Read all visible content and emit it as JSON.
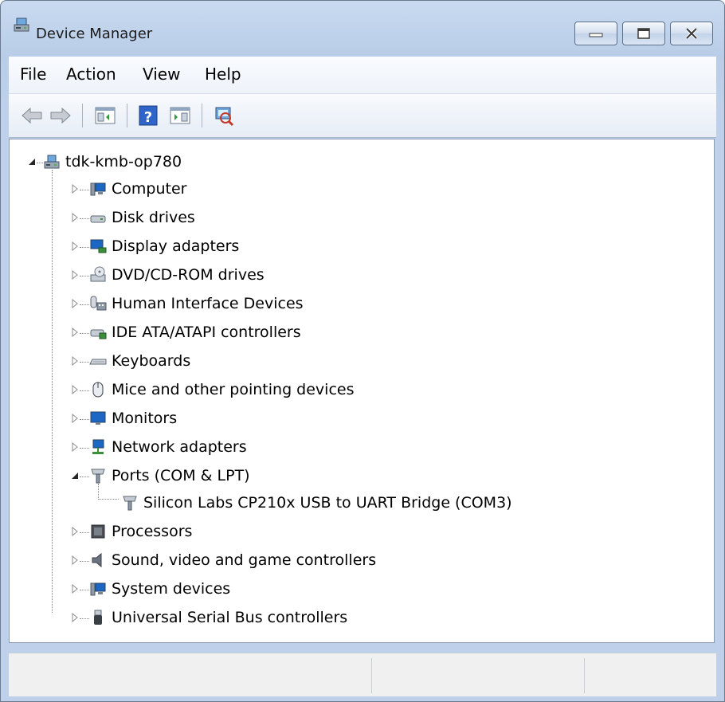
{
  "window": {
    "title": "Device Manager",
    "app_icon": "device-manager-icon",
    "caption_buttons": [
      "minimize-icon",
      "maximize-icon",
      "close-icon"
    ]
  },
  "menu": {
    "items": [
      "File",
      "Action",
      "View",
      "Help"
    ]
  },
  "toolbar": {
    "buttons": [
      "back-arrow-icon",
      "forward-arrow-icon",
      "show-hide-tree-icon",
      "help-icon",
      "properties-icon",
      "scan-hardware-icon"
    ]
  },
  "tree": {
    "root": {
      "label": "tdk-kmb-op780",
      "icon": "computer-workstation-icon",
      "expanded": true
    },
    "categories": [
      {
        "label": "Computer",
        "icon": "computer-icon",
        "expanded": false
      },
      {
        "label": "Disk drives",
        "icon": "disk-drive-icon",
        "expanded": false
      },
      {
        "label": "Display adapters",
        "icon": "display-adapter-icon",
        "expanded": false
      },
      {
        "label": "DVD/CD-ROM drives",
        "icon": "dvd-drive-icon",
        "expanded": false
      },
      {
        "label": "Human Interface Devices",
        "icon": "hid-icon",
        "expanded": false
      },
      {
        "label": "IDE ATA/ATAPI controllers",
        "icon": "ide-controller-icon",
        "expanded": false
      },
      {
        "label": "Keyboards",
        "icon": "keyboard-icon",
        "expanded": false
      },
      {
        "label": "Mice and other pointing devices",
        "icon": "mouse-icon",
        "expanded": false
      },
      {
        "label": "Monitors",
        "icon": "monitor-icon",
        "expanded": false
      },
      {
        "label": "Network adapters",
        "icon": "network-adapter-icon",
        "expanded": false
      },
      {
        "label": "Ports (COM & LPT)",
        "icon": "port-icon",
        "expanded": true,
        "children": [
          {
            "label": "Silicon Labs CP210x USB to UART Bridge (COM3)",
            "icon": "port-icon"
          }
        ]
      },
      {
        "label": "Processors",
        "icon": "processor-icon",
        "expanded": false
      },
      {
        "label": "Sound, video and game controllers",
        "icon": "speaker-icon",
        "expanded": false
      },
      {
        "label": "System devices",
        "icon": "system-device-icon",
        "expanded": false
      },
      {
        "label": "Universal Serial Bus controllers",
        "icon": "usb-icon",
        "expanded": false
      }
    ]
  },
  "statusbar": {
    "panes": [
      "",
      "",
      ""
    ]
  },
  "colors": {
    "titlebar": "#c9daf0",
    "selection": "#3399ff",
    "tree_bg": "#ffffff"
  }
}
